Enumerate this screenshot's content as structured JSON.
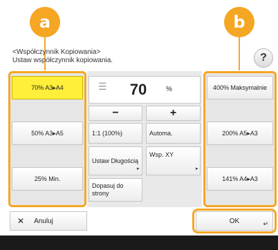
{
  "callouts": {
    "a": "a",
    "b": "b"
  },
  "header": {
    "title_line1": "<Współczynnik Kopiowania>",
    "title_line2": "Ustaw współczynnik kopiowania.",
    "help_label": "?"
  },
  "left_presets": [
    {
      "label": "70% A3▸A4",
      "selected": true
    },
    {
      "label": "50% A3▸A5",
      "selected": false
    },
    {
      "label": "25% Min.",
      "selected": false
    }
  ],
  "right_presets": [
    {
      "label": "400% Maksymalnie"
    },
    {
      "label": "200% A5▸A3"
    },
    {
      "label": "141% A4▸A3"
    }
  ],
  "zoom": {
    "value": "70",
    "unit": "%"
  },
  "controls": {
    "minus": "−",
    "plus": "+",
    "one_to_one": "1:1 (100%)",
    "auto": "Automa.",
    "set_ratio": "Ustaw Długością",
    "xy_ratio": "Wsp. XY",
    "fit_page": "Dopasuj do strony"
  },
  "footer": {
    "cancel_label": "Anuluj",
    "ok_label": "OK"
  },
  "colors": {
    "accent": "#f5a623",
    "selected": "#ffef3a"
  }
}
